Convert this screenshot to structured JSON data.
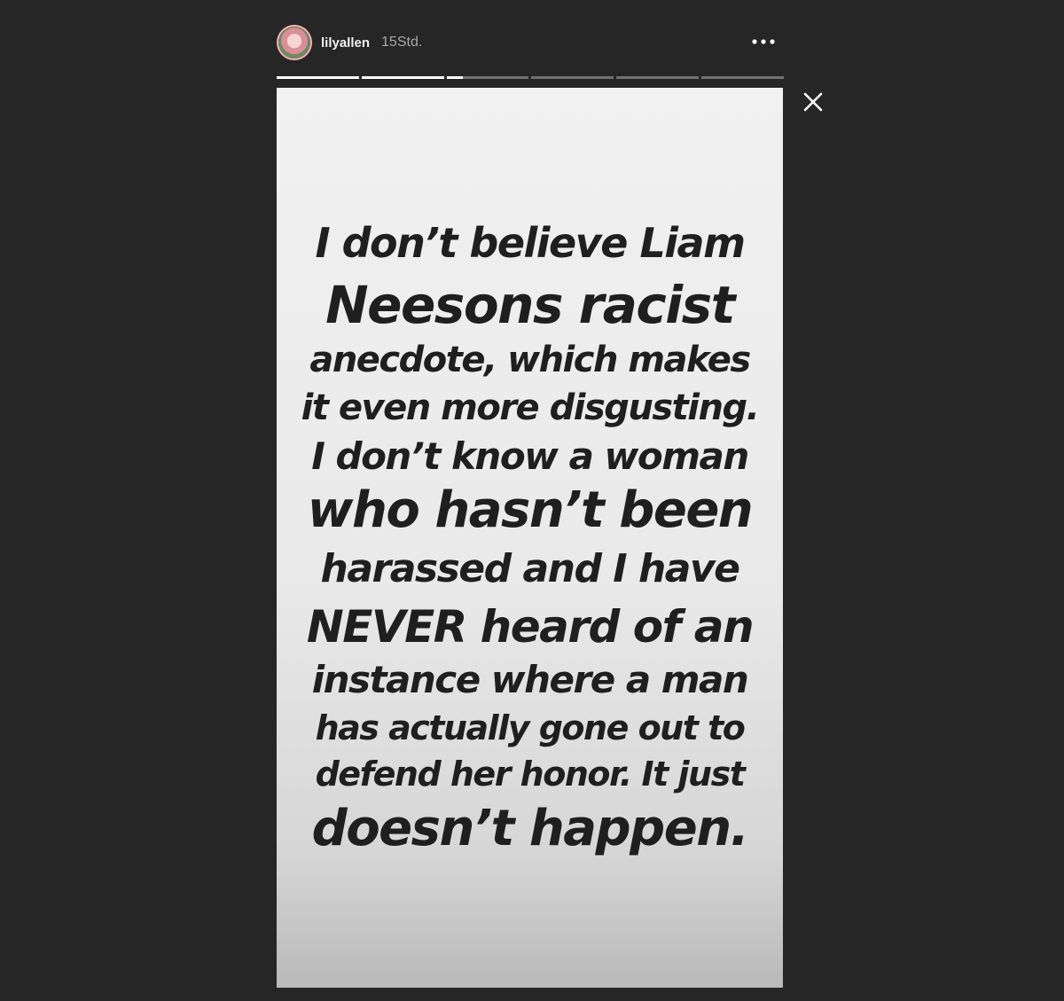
{
  "header": {
    "username": "lilyallen",
    "timestamp": "15Std.",
    "avatar_icon": "profile-photo",
    "more_icon": "more-horizontal-icon"
  },
  "progress": {
    "segments": [
      1,
      1,
      0.2,
      0,
      0,
      0
    ]
  },
  "close_icon": "close-icon",
  "story": {
    "lines": [
      "I don’t believe Liam",
      "Neesons racist",
      "anecdote, which makes",
      "it even more disgusting.",
      "I don’t know a woman",
      "who hasn’t been",
      "harassed and I have",
      "NEVER heard of an",
      "instance where a man",
      "has actually gone out to",
      "defend her honor. It just",
      "doesn’t happen."
    ]
  },
  "colors": {
    "background": "#262626",
    "text": "#1f1f1f",
    "accent_ring": "#f3b5bd"
  }
}
